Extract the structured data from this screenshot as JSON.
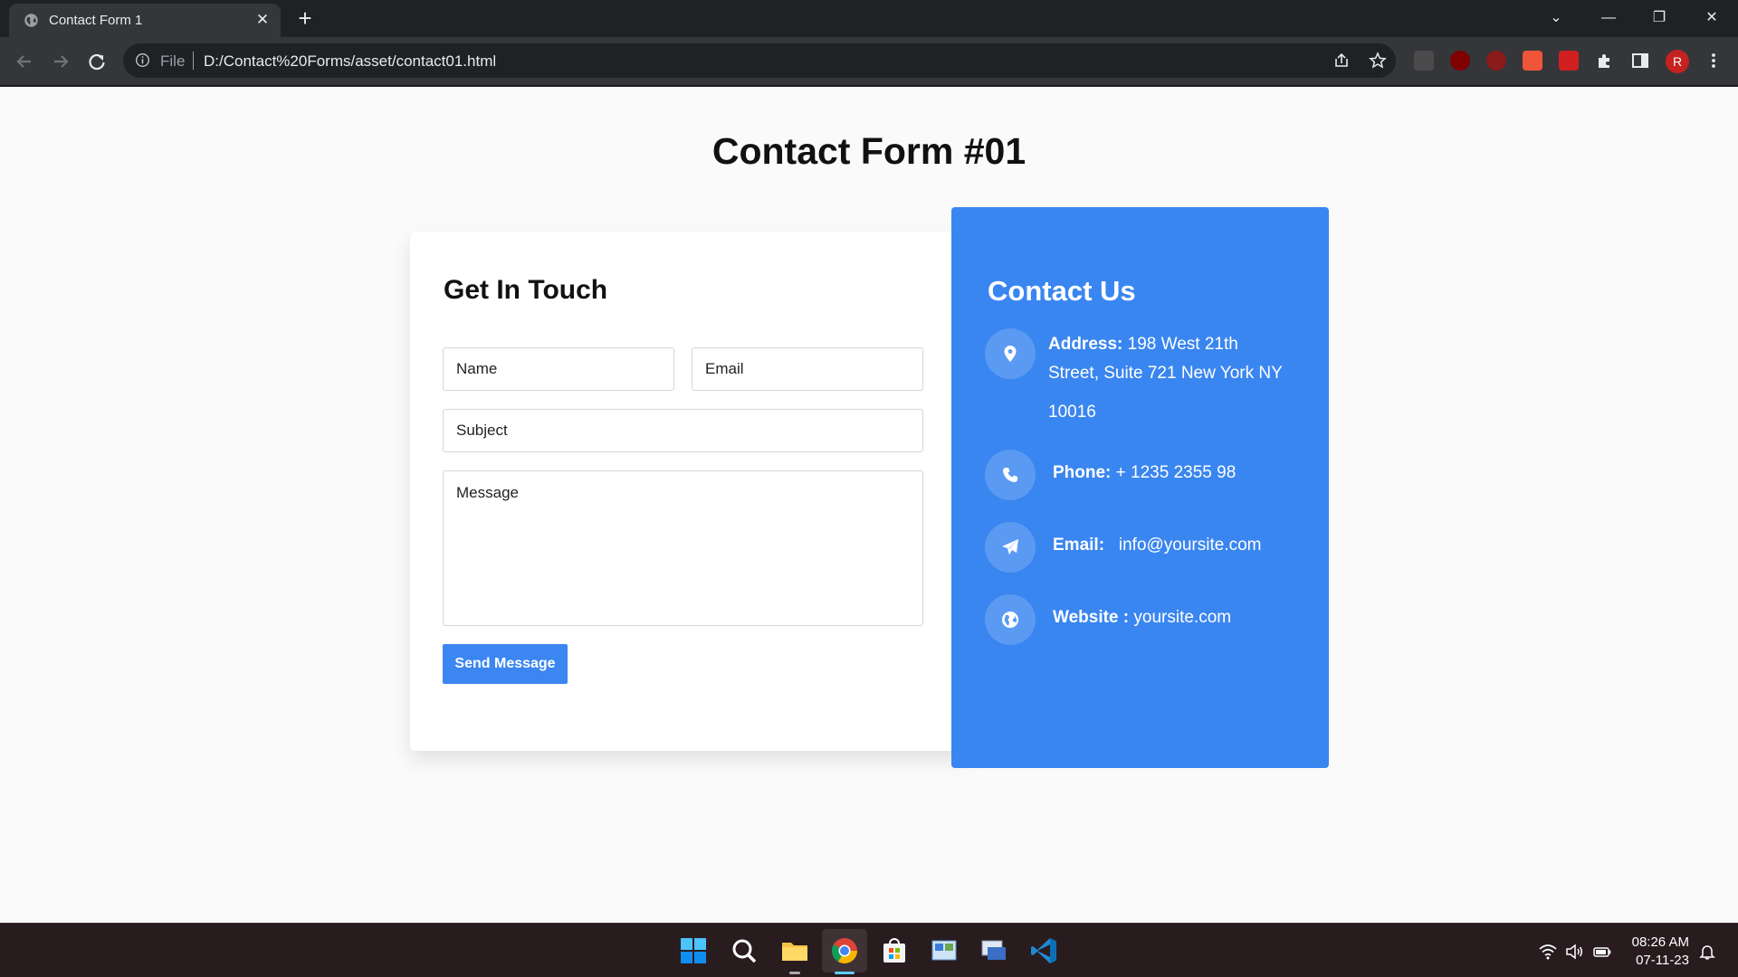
{
  "browser": {
    "tab_title": "Contact Form 1",
    "address_prefix": "File",
    "url": "D:/Contact%20Forms/asset/contact01.html",
    "profile_initial": "R"
  },
  "page": {
    "title": "Contact Form #01"
  },
  "form": {
    "heading": "Get In Touch",
    "name_placeholder": "Name",
    "email_placeholder": "Email",
    "subject_placeholder": "Subject",
    "message_placeholder": "Message",
    "submit_label": "Send Message"
  },
  "contact": {
    "heading": "Contact Us",
    "address_label": "Address:",
    "address_line1": "198 West 21th",
    "address_line2": "Street, Suite 721 New York NY",
    "address_line3": "10016",
    "phone_label": "Phone:",
    "phone_value": "+ 1235 2355 98",
    "email_label": "Email:",
    "email_value": "info@yoursite.com",
    "website_label": "Website :",
    "website_value": "yoursite.com"
  },
  "taskbar": {
    "time": "08:26 AM",
    "date": "07-11-23"
  },
  "colors": {
    "accent": "#3a86f0",
    "button": "#3b86f1",
    "page_bg": "#fafafa"
  }
}
